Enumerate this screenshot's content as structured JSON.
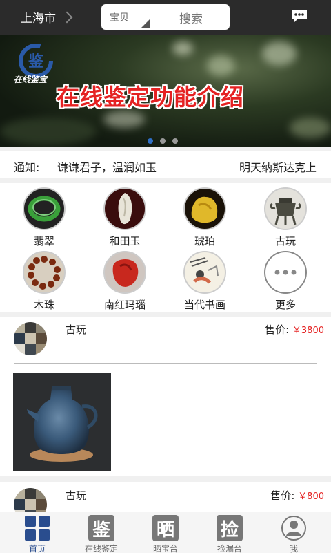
{
  "header": {
    "city": "上海市",
    "search_category": "宝贝",
    "search_button": "搜索"
  },
  "banner": {
    "logo_char": "鉴",
    "logo_text": "在线鉴宝",
    "title": "在线鉴定功能介绍",
    "dots": 3,
    "active_dot": 0
  },
  "notice": {
    "label": "通知:",
    "text": "谦谦君子，温润如玉",
    "text2": "明天纳斯达克上"
  },
  "categories": [
    {
      "label": "翡翠",
      "icon": "jade-bangle-icon"
    },
    {
      "label": "和田玉",
      "icon": "hetian-jade-icon"
    },
    {
      "label": "琥珀",
      "icon": "amber-icon"
    },
    {
      "label": "古玩",
      "icon": "antique-bronze-icon"
    },
    {
      "label": "木珠",
      "icon": "wood-beads-icon"
    },
    {
      "label": "南红玛瑙",
      "icon": "red-agate-icon"
    },
    {
      "label": "当代书画",
      "icon": "painting-icon"
    },
    {
      "label": "更多",
      "icon": "more-icon"
    }
  ],
  "products": [
    {
      "name": "古玩",
      "price_label": "售价:",
      "price": "￥3800"
    },
    {
      "name": "古玩",
      "price_label": "售价:",
      "price": "￥800"
    }
  ],
  "nav": [
    {
      "label": "首页",
      "icon_char": "",
      "active": true
    },
    {
      "label": "在线鉴定",
      "icon_char": "鉴",
      "active": false
    },
    {
      "label": "晒宝台",
      "icon_char": "晒",
      "active": false
    },
    {
      "label": "捡漏台",
      "icon_char": "捡",
      "active": false
    },
    {
      "label": "我",
      "icon_char": "",
      "active": false
    }
  ],
  "colors": {
    "header_bg": "#2b2b2b",
    "accent_red": "#e52222",
    "nav_active": "#2a4d8e"
  }
}
